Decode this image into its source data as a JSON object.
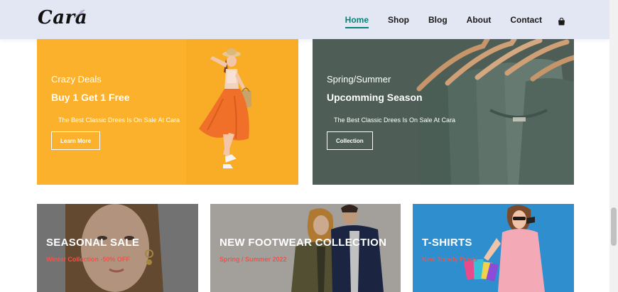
{
  "header": {
    "logo_text": "Cara",
    "nav": [
      "Home",
      "Shop",
      "Blog",
      "About",
      "Contact"
    ],
    "active_nav": "Home",
    "cart_icon": "shopping-bag-icon"
  },
  "banners": [
    {
      "kicker": "Crazy Deals",
      "headline": "Buy 1 Get 1 Free",
      "subtitle": "The Best Classic Drees Is On Sale At Cara",
      "button": "Learn More"
    },
    {
      "kicker": "Spring/Summer",
      "headline": "Upcomming Season",
      "subtitle": "The Best Classic Drees Is On Sale At Cara",
      "button": "Collection"
    }
  ],
  "small_banners": [
    {
      "title": "SEASONAL SALE",
      "subtitle": "Winter Collection -50% OFF"
    },
    {
      "title": "NEW FOOTWEAR COLLECTION",
      "subtitle": "Spring / Summer 2022"
    },
    {
      "title": "T-SHIRTS",
      "subtitle": "New Trendy Prints"
    }
  ],
  "colors": {
    "header_bg": "#e3e6f3",
    "accent": "#088178",
    "promo_red": "#ec544e",
    "banner_yellow": "#fbb12c",
    "banner_green": "#5b6e68",
    "banner_blue": "#2f8ecd"
  }
}
